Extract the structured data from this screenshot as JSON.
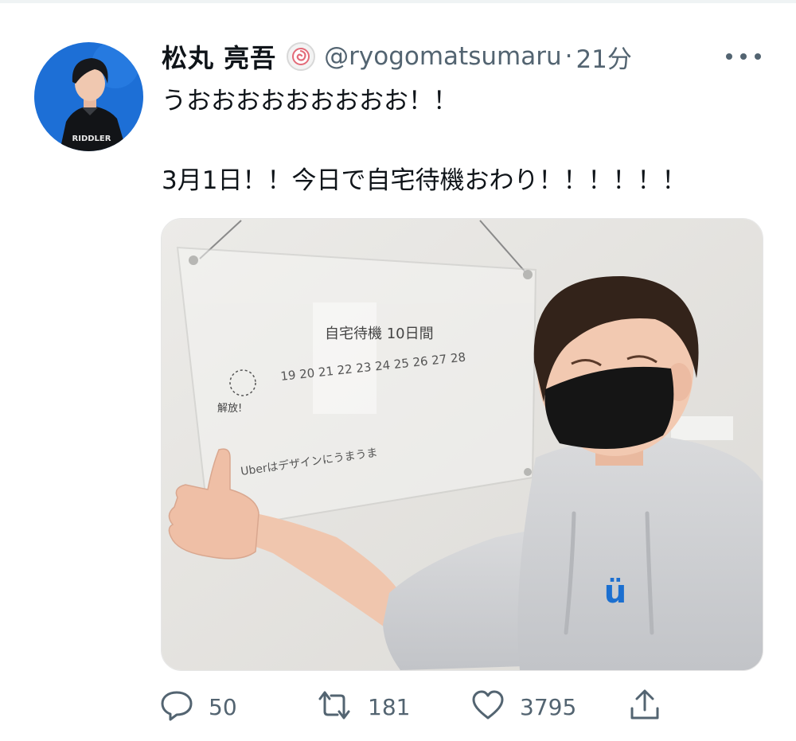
{
  "tweet": {
    "author": {
      "display_name": "松丸 亮吾",
      "handle": "@ryogomatsumaru",
      "separator": "·",
      "time": "21分",
      "avatar_shirt_text": "RIDDLER"
    },
    "text_line1": "うおおおおおおおおお！！",
    "text_line2": "3月1日！！今日で自宅待機おわり！！！！！！",
    "media": {
      "board_title": "自宅待機 10日間",
      "board_dates": "19 20 21 22 23 24 25 26 27 28",
      "board_note": "Uberはデザインにうまうま",
      "board_side_label": "解放!",
      "hoodie_logo": "ü"
    },
    "actions": {
      "replies": "50",
      "retweets": "181",
      "likes": "3795"
    }
  },
  "colors": {
    "text": "#0f1419",
    "secondary": "#536471",
    "avatar_bg": "#1d6fd6",
    "hoodie_logo": "#1b6fd0"
  },
  "icons": [
    "more-icon",
    "badge-icon",
    "reply-icon",
    "retweet-icon",
    "like-icon",
    "share-icon"
  ]
}
